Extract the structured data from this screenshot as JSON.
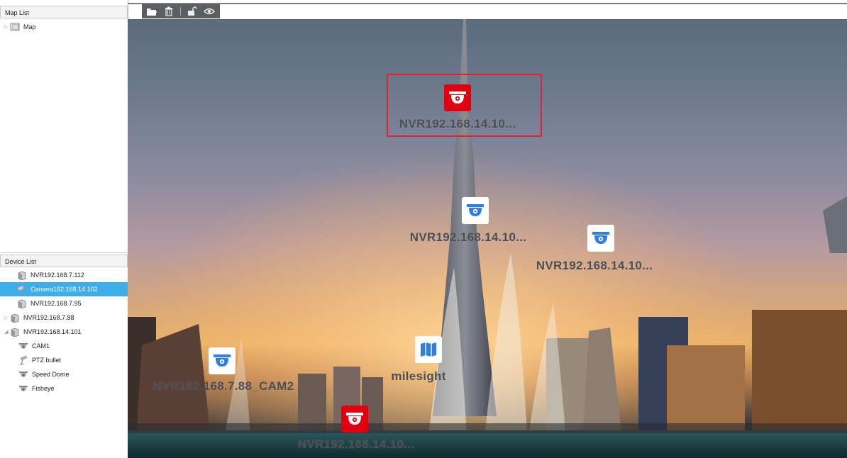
{
  "map_list": {
    "header": "Map List",
    "items": [
      {
        "label": "Map",
        "icon": "map-folder-icon"
      }
    ]
  },
  "device_list": {
    "header": "Device List",
    "items": [
      {
        "label": "NVR192.168.7.112",
        "icon": "nvr-icon",
        "indent": 1,
        "arrow": ""
      },
      {
        "label": "Camera192.168.14.102",
        "icon": "camera-icon",
        "indent": 1,
        "arrow": "",
        "selected": true
      },
      {
        "label": "NVR192.168.7.95",
        "icon": "nvr-icon",
        "indent": 1,
        "arrow": ""
      },
      {
        "label": "NVR192.168.7.88",
        "icon": "nvr-icon",
        "indent": 0,
        "arrow": "▷"
      },
      {
        "label": "NVR192.168.14.101",
        "icon": "nvr-icon",
        "indent": 0,
        "arrow": "◢"
      },
      {
        "label": "CAM1",
        "icon": "dome-camera-icon",
        "indent": 2,
        "arrow": ""
      },
      {
        "label": "PTZ bullet",
        "icon": "ptz-bullet-icon",
        "indent": 2,
        "arrow": ""
      },
      {
        "label": "Speed Dome",
        "icon": "dome-camera-icon",
        "indent": 2,
        "arrow": ""
      },
      {
        "label": "Fisheye",
        "icon": "dome-camera-icon",
        "indent": 2,
        "arrow": ""
      }
    ]
  },
  "toolbar": {
    "buttons": [
      "open-folder-icon",
      "delete-icon",
      "unlock-icon",
      "preview-eye-icon"
    ]
  },
  "map": {
    "markers": [
      {
        "label": "NVR192.168.14.10...",
        "type": "camera",
        "color": "red",
        "selected": true
      },
      {
        "label": "NVR192.168.14.10...",
        "type": "camera",
        "color": "white"
      },
      {
        "label": "NVR192.168.14.10...",
        "type": "camera",
        "color": "white"
      },
      {
        "label": "NVR192.168.7.88_CAM2",
        "type": "camera",
        "color": "white"
      },
      {
        "label": "milesight",
        "type": "map",
        "color": "white"
      },
      {
        "label": "NVR192.168.14.10...",
        "type": "camera",
        "color": "red"
      }
    ]
  },
  "colors": {
    "accent_selected": "#3daee9",
    "alarm_red": "#e1000f",
    "marker_blue": "#2f7fe0",
    "selection_border": "#e1232b"
  }
}
